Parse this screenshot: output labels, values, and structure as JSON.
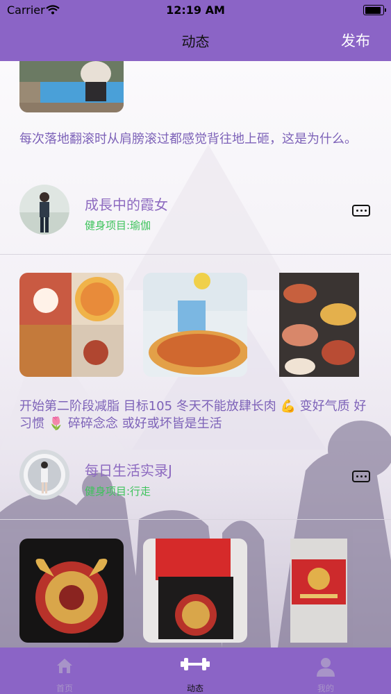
{
  "status_bar": {
    "carrier": "Carrier",
    "time": "12:19 AM"
  },
  "nav": {
    "title": "动态",
    "publish_label": "发布"
  },
  "posts": [
    {
      "text": "每次落地翻滚时从肩膀滚过都感觉背往地上砸，这是为什么。",
      "user": "成長中的霞女",
      "project": "健身项目:瑜伽"
    },
    {
      "text": "开始第二阶段减脂 目标105 冬天不能放肆长肉 💪 变好气质 好习惯 🌷 碎碎念念 或好或坏皆是生活",
      "user": "每日生活实录J",
      "project": "健身项目:行走"
    }
  ],
  "tabs": [
    {
      "label": "首页",
      "icon": "home-icon",
      "active": false
    },
    {
      "label": "动态",
      "icon": "dumbbell-icon",
      "active": true
    },
    {
      "label": "我的",
      "icon": "person-icon",
      "active": false
    }
  ],
  "colors": {
    "header": "#8b64c6",
    "post_text": "#7d62b8",
    "project_text": "#3dc35b",
    "inactive_tab": "#a894c8"
  }
}
